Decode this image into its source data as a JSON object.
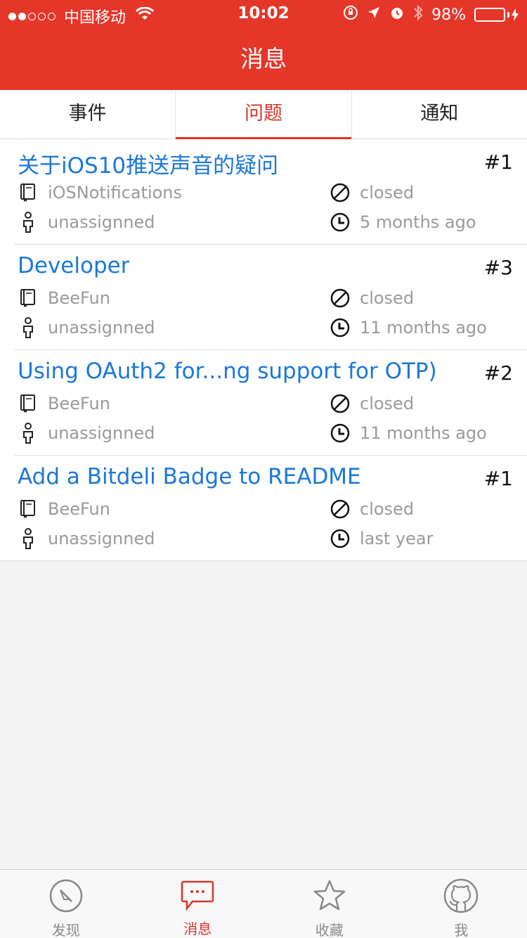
{
  "status_bar": {
    "carrier": "中国移动",
    "time": "10:02",
    "battery": "98%",
    "battery_level": 0.98
  },
  "nav": {
    "title": "消息"
  },
  "tabs": [
    {
      "label": "事件",
      "active": false
    },
    {
      "label": "问题",
      "active": true
    },
    {
      "label": "通知",
      "active": false
    }
  ],
  "issues": [
    {
      "title": "关于iOS10推送声音的疑问",
      "number": "#1",
      "repo": "iOSNotifications",
      "state": "closed",
      "assignee": "unassignned",
      "time": "5 months ago"
    },
    {
      "title": "Developer",
      "number": "#3",
      "repo": "BeeFun",
      "state": "closed",
      "assignee": "unassignned",
      "time": "11 months ago"
    },
    {
      "title": "Using OAuth2 for...ng support for OTP)",
      "number": "#2",
      "repo": "BeeFun",
      "state": "closed",
      "assignee": "unassignned",
      "time": "11 months ago"
    },
    {
      "title": "Add a Bitdeli Badge to README",
      "number": "#1",
      "repo": "BeeFun",
      "state": "closed",
      "assignee": "unassignned",
      "time": "last year"
    }
  ],
  "tabbar": [
    {
      "label": "发现",
      "icon": "compass-icon",
      "active": false
    },
    {
      "label": "消息",
      "icon": "message-icon",
      "active": true
    },
    {
      "label": "收藏",
      "icon": "star-icon",
      "active": false
    },
    {
      "label": "我",
      "icon": "github-icon",
      "active": false
    }
  ],
  "colors": {
    "accent": "#e5362a",
    "link": "#1b78d8",
    "muted": "#9a9a9a"
  }
}
